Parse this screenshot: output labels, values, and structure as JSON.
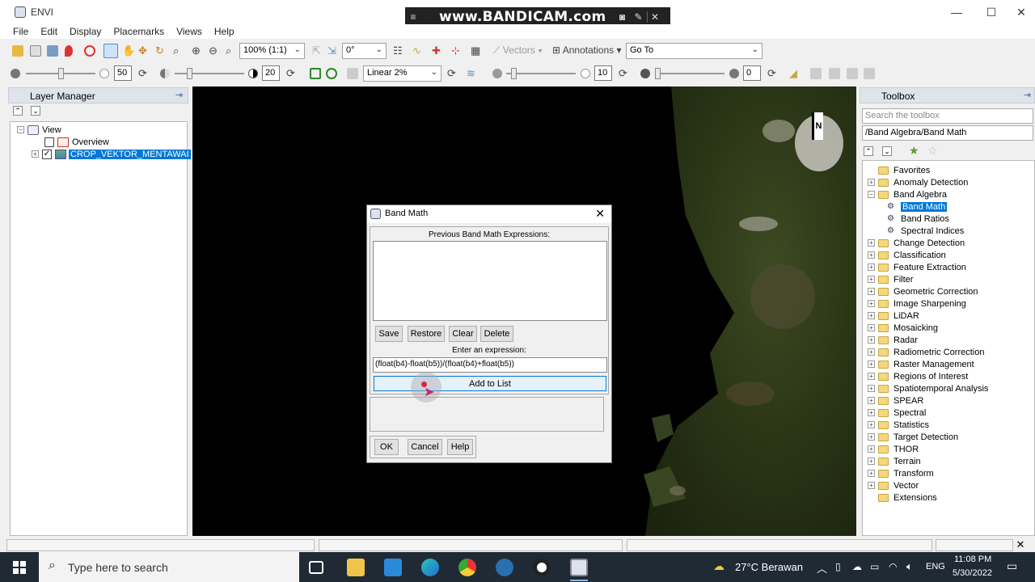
{
  "window": {
    "title": "ENVI"
  },
  "recorder": {
    "brand": "www.BANDICAM.com"
  },
  "menubar": [
    "File",
    "Edit",
    "Display",
    "Placemarks",
    "Views",
    "Help"
  ],
  "toolbar": {
    "zoom": "100% (1:1)",
    "rotation": "0°",
    "vectors": "Vectors",
    "annotations": "Annotations",
    "goto": "Go To",
    "brightness": "50",
    "contrast": "20",
    "stretch": "Linear 2%",
    "sharpen": "10",
    "transparency": "0"
  },
  "layer_manager": {
    "title": "Layer Manager",
    "view_label": "View",
    "overview_label": "Overview",
    "layer_label": "CROP_VEKTOR_MENTAWAI"
  },
  "band_math": {
    "title": "Band Math",
    "previous_label": "Previous Band Math Expressions:",
    "save": "Save",
    "restore": "Restore",
    "clear": "Clear",
    "delete": "Delete",
    "enter_label": "Enter an expression:",
    "expression": "(float(b4)-float(b5))/(float(b4)+float(b5))",
    "add_to_list": "Add to List",
    "ok": "OK",
    "cancel": "Cancel",
    "help": "Help"
  },
  "toolbox": {
    "title": "Toolbox",
    "search_placeholder": "Search the toolbox",
    "path": "/Band Algebra/Band Math",
    "items": [
      {
        "label": "Favorites",
        "level": 0,
        "type": "folder",
        "expander": ""
      },
      {
        "label": "Anomaly Detection",
        "level": 0,
        "type": "folder",
        "expander": "+"
      },
      {
        "label": "Band Algebra",
        "level": 0,
        "type": "folder",
        "expander": "−"
      },
      {
        "label": "Band Math",
        "level": 1,
        "type": "tool",
        "selected": true
      },
      {
        "label": "Band Ratios",
        "level": 1,
        "type": "tool"
      },
      {
        "label": "Spectral Indices",
        "level": 1,
        "type": "tool"
      },
      {
        "label": "Change Detection",
        "level": 0,
        "type": "folder",
        "expander": "+"
      },
      {
        "label": "Classification",
        "level": 0,
        "type": "folder",
        "expander": "+"
      },
      {
        "label": "Feature Extraction",
        "level": 0,
        "type": "folder",
        "expander": "+"
      },
      {
        "label": "Filter",
        "level": 0,
        "type": "folder",
        "expander": "+"
      },
      {
        "label": "Geometric Correction",
        "level": 0,
        "type": "folder",
        "expander": "+"
      },
      {
        "label": "Image Sharpening",
        "level": 0,
        "type": "folder",
        "expander": "+"
      },
      {
        "label": "LiDAR",
        "level": 0,
        "type": "folder",
        "expander": "+"
      },
      {
        "label": "Mosaicking",
        "level": 0,
        "type": "folder",
        "expander": "+"
      },
      {
        "label": "Radar",
        "level": 0,
        "type": "folder",
        "expander": "+"
      },
      {
        "label": "Radiometric Correction",
        "level": 0,
        "type": "folder",
        "expander": "+"
      },
      {
        "label": "Raster Management",
        "level": 0,
        "type": "folder",
        "expander": "+"
      },
      {
        "label": "Regions of Interest",
        "level": 0,
        "type": "folder",
        "expander": "+"
      },
      {
        "label": "Spatiotemporal Analysis",
        "level": 0,
        "type": "folder",
        "expander": "+"
      },
      {
        "label": "SPEAR",
        "level": 0,
        "type": "folder",
        "expander": "+"
      },
      {
        "label": "Spectral",
        "level": 0,
        "type": "folder",
        "expander": "+"
      },
      {
        "label": "Statistics",
        "level": 0,
        "type": "folder",
        "expander": "+"
      },
      {
        "label": "Target Detection",
        "level": 0,
        "type": "folder",
        "expander": "+"
      },
      {
        "label": "THOR",
        "level": 0,
        "type": "folder",
        "expander": "+"
      },
      {
        "label": "Terrain",
        "level": 0,
        "type": "folder",
        "expander": "+"
      },
      {
        "label": "Transform",
        "level": 0,
        "type": "folder",
        "expander": "+"
      },
      {
        "label": "Vector",
        "level": 0,
        "type": "folder",
        "expander": "+"
      },
      {
        "label": "Extensions",
        "level": 0,
        "type": "folder",
        "expander": ""
      }
    ]
  },
  "map": {
    "north_label": "N"
  },
  "taskbar": {
    "search_placeholder": "Type here to search",
    "weather": "27°C Berawan",
    "language": "ENG",
    "time": "11:08 PM",
    "date": "5/30/2022"
  },
  "colors": {
    "accent": "#0078d7",
    "map_bg": "#000000",
    "taskbar": "#1f2a35"
  }
}
